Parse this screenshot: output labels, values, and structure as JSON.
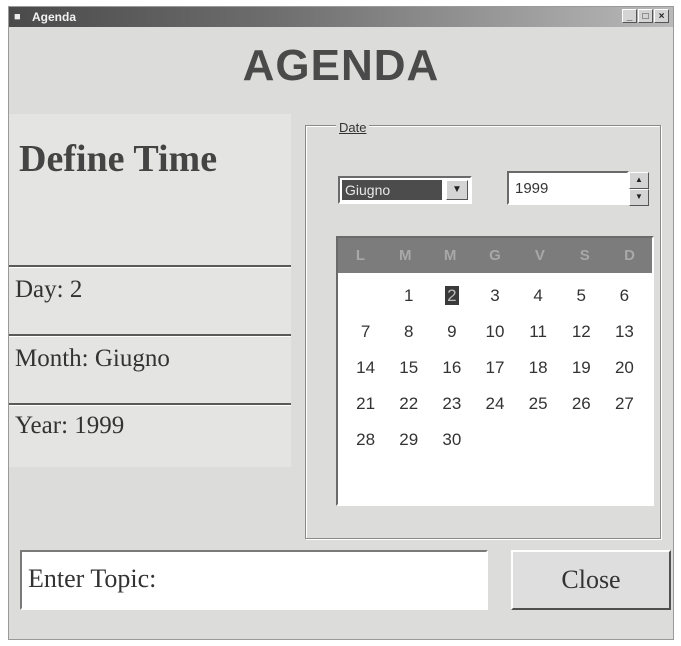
{
  "window": {
    "title": "Agenda",
    "buttons": [
      "_",
      "□",
      "×"
    ]
  },
  "header": {
    "title": "AGENDA"
  },
  "left": {
    "heading": "Define Time",
    "day": "Day: 2",
    "month": "Month: Giugno",
    "year": "Year: 1999"
  },
  "date_group": {
    "legend": "Date",
    "month_select": {
      "value": "Giugno"
    },
    "year_input": {
      "value": "1999"
    }
  },
  "calendar": {
    "weekdays": [
      "L",
      "M",
      "M",
      "G",
      "V",
      "S",
      "D"
    ],
    "selected_day": "2",
    "days": [
      "",
      "1",
      "2",
      "3",
      "4",
      "5",
      "6",
      "7",
      "8",
      "9",
      "10",
      "11",
      "12",
      "13",
      "14",
      "15",
      "16",
      "17",
      "18",
      "19",
      "20",
      "21",
      "22",
      "23",
      "24",
      "25",
      "26",
      "27",
      "28",
      "29",
      "30",
      "",
      "",
      "",
      ""
    ]
  },
  "footer": {
    "topic_label": "Enter Topic:",
    "close_label": "Close"
  },
  "icons": {
    "app": "app-icon",
    "dropdown": "chevron-down-icon",
    "spin_up": "chevron-up-icon",
    "spin_down": "chevron-down-icon"
  }
}
